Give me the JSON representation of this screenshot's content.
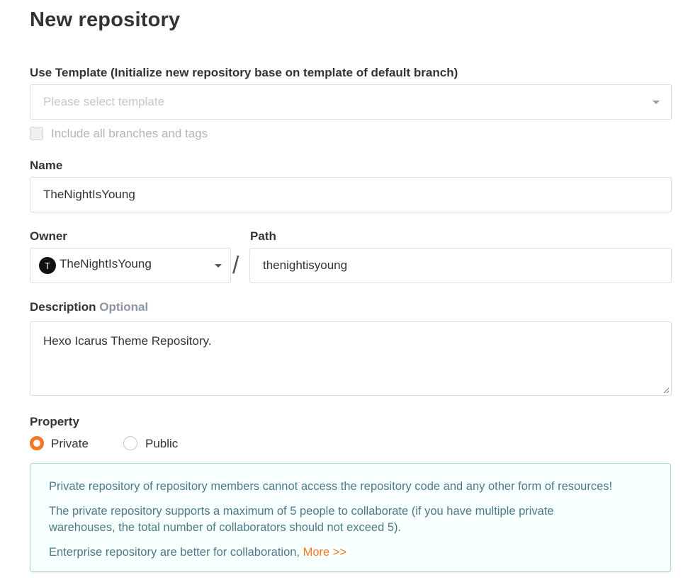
{
  "page": {
    "title": "New repository"
  },
  "template": {
    "label": "Use Template (Initialize new repository base on template of default branch)",
    "placeholder": "Please select template",
    "include_branches_label": "Include all branches and tags"
  },
  "name": {
    "label": "Name",
    "value": "TheNightIsYoung"
  },
  "owner": {
    "label": "Owner",
    "avatar_letter": "T",
    "value": "TheNightIsYoung"
  },
  "path": {
    "label": "Path",
    "separator": "/",
    "value": "thenightisyoung"
  },
  "description": {
    "label": "Description",
    "optional": "Optional",
    "value": "Hexo Icarus Theme Repository."
  },
  "property": {
    "label": "Property",
    "options": [
      {
        "label": "Private",
        "selected": true
      },
      {
        "label": "Public",
        "selected": false
      }
    ]
  },
  "notice": {
    "line1": "Private repository of repository members cannot access the repository code and any other form of resources!",
    "line2a": "The private repository supports a maximum of 5 people to collaborate (if you have multiple private",
    "line2b": "warehouses, the total number of collaborators should not exceed 5).",
    "line3": "Enterprise repository are better for collaboration,",
    "more_link": "More >>"
  },
  "colors": {
    "accent": "#f5761e",
    "notice_text": "#4b7a87",
    "notice_border": "#a8d8dc",
    "notice_bg": "#f8ffff"
  },
  "icons": {
    "dropdown": "chevron-down-icon",
    "resize": "resize-handle-icon"
  }
}
